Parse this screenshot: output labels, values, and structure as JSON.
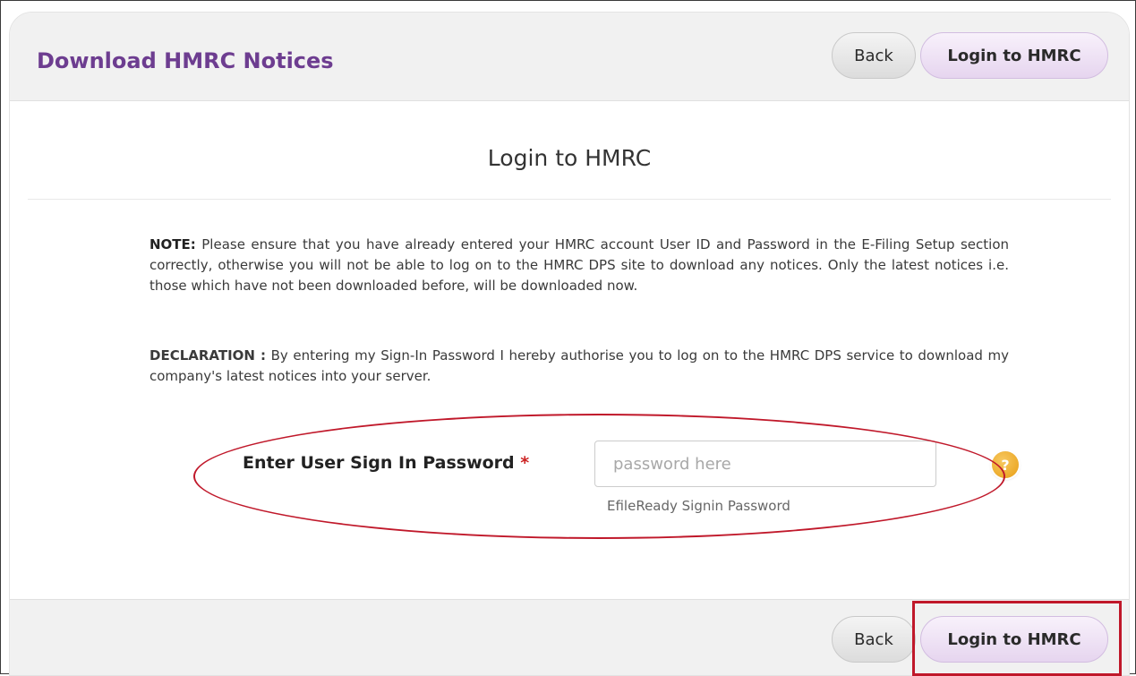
{
  "header": {
    "title": "Download HMRC Notices",
    "back_label": "Back",
    "login_label": "Login to HMRC"
  },
  "main": {
    "title": "Login to HMRC",
    "note_prefix": "NOTE:",
    "note_text": " Please ensure that you have already entered your HMRC account User ID and Password in the E-Filing Setup section correctly, otherwise you will not be able to log on to the HMRC DPS site to download any notices. Only the latest notices i.e. those which have not been downloaded before, will be downloaded now.",
    "declaration_prefix": "DECLARATION :",
    "declaration_text": " By entering my Sign-In Password I hereby authorise you to log on to the HMRC DPS service to download my company's latest notices into your server.",
    "password_label": "Enter User Sign In Password",
    "required_marker": "*",
    "password_placeholder": "password here",
    "password_value": "",
    "password_help": "EfileReady Signin Password",
    "help_icon_glyph": "?"
  },
  "footer": {
    "back_label": "Back",
    "login_label": "Login to HMRC"
  },
  "colors": {
    "accent": "#6d3d90",
    "annotation_red": "#c0182a",
    "help_icon": "#e89e14"
  }
}
